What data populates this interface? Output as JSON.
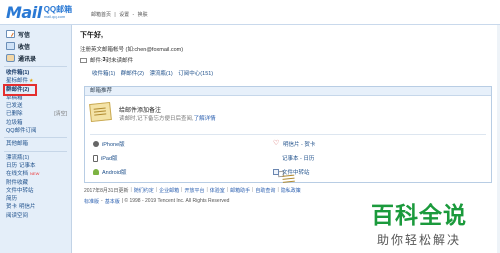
{
  "header": {
    "logo_mail": "Mail",
    "logo_qq": "QQ邮箱",
    "logo_domain": "mail.qq.com",
    "links": [
      "邮箱首页",
      "|",
      "设置",
      "-",
      "换肤"
    ]
  },
  "sidebar": {
    "quick": [
      {
        "label": "写信",
        "icon": "write-icon"
      },
      {
        "label": "收信",
        "icon": "inbox-icon"
      },
      {
        "label": "通讯录",
        "icon": "contacts-icon"
      }
    ],
    "folders": [
      {
        "label": "收件箱(1)",
        "bold": true
      },
      {
        "label": "星标邮件",
        "star": true
      },
      {
        "label": "群邮件(2)",
        "bold": true
      },
      {
        "label": "草稿箱"
      },
      {
        "label": "已发送"
      },
      {
        "label": "已删除",
        "clear": "[清空]"
      },
      {
        "label": "垃圾箱"
      },
      {
        "label": "QQ邮件订阅"
      }
    ],
    "other_header": "其他邮箱",
    "extras": [
      {
        "label": "漂流瓶(1)"
      },
      {
        "label": "日历",
        "label2": "记事本"
      },
      {
        "label": "在线文档",
        "new": "NEW"
      },
      {
        "label": "附件收藏"
      },
      {
        "label": "文件中转站"
      },
      {
        "label": "简历"
      },
      {
        "label": "贺卡",
        "label2": "明信片"
      },
      {
        "label": "阅读空间"
      }
    ],
    "highlight_color": "#e42e2e"
  },
  "main": {
    "greeting": "下午好,",
    "account_prefix": "注册英文邮箱帐号",
    "account_suffix": "(如:chen@foxmail.com)",
    "status_prefix": "邮件:",
    "status_count": "3",
    "status_suffix": "封未读邮件",
    "counts": [
      "收件箱(1)",
      "群邮件(2)",
      "漂流瓶(1)",
      "订阅中心(151)"
    ]
  },
  "panel": {
    "title": "邮箱推荐",
    "rec_title": "给邮件添加备注",
    "rec_desc": "读邮时,记下备忘方便日后查阅,",
    "rec_link": "了解详情",
    "apps_left": [
      {
        "label": "iPhone版",
        "icon": "apple-icon"
      },
      {
        "label": "iPad版",
        "icon": "ipad-icon"
      },
      {
        "label": "Android版",
        "icon": "android-icon"
      }
    ],
    "apps_right": [
      {
        "label": "明信片 - 贺卡",
        "icon": "heart-icon"
      },
      {
        "label": "记事本 - 日历",
        "icon": "notepad-icon"
      },
      {
        "label": "文件中转站",
        "icon": "file-icon"
      }
    ]
  },
  "footer": {
    "line1": [
      "2017年8月31日更新",
      "|",
      "随们约定",
      "|",
      "企业邮箱",
      "|",
      "开放平台",
      "|",
      "体验室",
      "|",
      "邮箱助手",
      "|",
      "自助查询",
      "|",
      "隐私政策"
    ],
    "line2_links": [
      "标准版",
      "-",
      "基本版"
    ],
    "copyright": "|  © 1998 - 2019 Tencent Inc. All Rights Reserved"
  },
  "watermark": {
    "main": "百科全说",
    "sub": "助你轻松解决",
    "color": "#1b9a3c"
  }
}
